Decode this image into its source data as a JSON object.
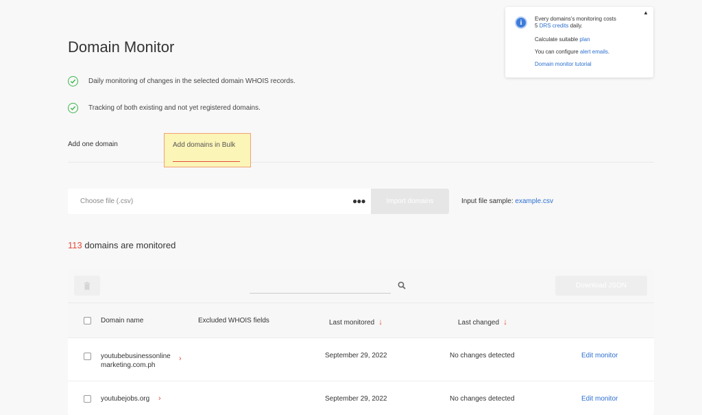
{
  "page": {
    "title": "Domain Monitor"
  },
  "features": [
    "Daily monitoring of changes in the selected domain WHOIS records.",
    "Tracking of both existing and not yet registered domains."
  ],
  "tabs": {
    "one": "Add one domain",
    "bulk": "Add domains in Bulk"
  },
  "import": {
    "file_placeholder": "Choose file (.csv)",
    "button": "Import domains",
    "sample_label": "Input file sample:",
    "sample_link": "example.csv"
  },
  "count": {
    "number": "113",
    "text": "domains are monitored"
  },
  "table": {
    "download_button": "Download JSON",
    "headers": {
      "domain": "Domain name",
      "excluded": "Excluded WHOIS fields",
      "last_monitored": "Last monitored",
      "last_changed": "Last changed"
    },
    "rows": [
      {
        "domain_line1": "youtubebusinessonline",
        "domain_line2": "marketing.com.ph",
        "last_monitored": "September 29, 2022",
        "last_changed": "No changes detected",
        "action": "Edit monitor"
      },
      {
        "domain_line1": "youtubejobs.org",
        "domain_line2": "",
        "last_monitored": "September 29, 2022",
        "last_changed": "No changes detected",
        "action": "Edit monitor"
      }
    ]
  },
  "info": {
    "line1": "Every domains's monitoring costs",
    "line2_prefix": "5",
    "line2_link": "DRS credits",
    "line2_suffix": "daily.",
    "line3_prefix": "Calculate suitable",
    "line3_link": "plan",
    "line4_prefix": "You can configure",
    "line4_link": "alert emails",
    "line4_suffix": ".",
    "line5_link": "Domain monitor tutorial"
  },
  "colors": {
    "accent": "#e34a3a",
    "link": "#2d6fcf",
    "check": "#3bb54a",
    "highlight": "#fcf5b8"
  }
}
